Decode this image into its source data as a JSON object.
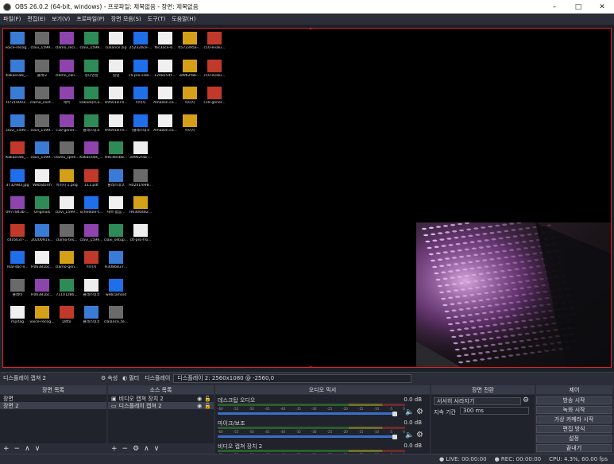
{
  "window": {
    "title": "OBS 26.0.2 (64-bit, windows) - 프로파일: 제목없음 - 장면: 제목없음"
  },
  "menu": [
    "파일(F)",
    "편집(E)",
    "보기(V)",
    "프로파일(P)",
    "장면 모음(S)",
    "도구(T)",
    "도움말(H)"
  ],
  "desktop_icons": [
    {
      "label": "voice-recog..."
    },
    {
      "label": "clavi_1599..."
    },
    {
      "label": "clamo_reci..."
    },
    {
      "label": "clavi_1599..."
    },
    {
      "label": "cialance.zip"
    },
    {
      "label": "252324ce-..."
    },
    {
      "label": "f6c3ace-6..."
    },
    {
      "label": "0572395a-..."
    },
    {
      "label": "c10-evalu..."
    },
    {
      "label": "KakaoTalk_..."
    },
    {
      "label": "클래모\n프로필"
    },
    {
      "label": "clamo_cali..."
    },
    {
      "label": "정다영실\n...-1.jpg"
    },
    {
      "label": "협업\n플러그인"
    },
    {
      "label": "cli-pro-side..."
    },
    {
      "label": "1248254f-..."
    },
    {
      "label": "3d962fab-...\n(1).jpg"
    },
    {
      "label": "c10-evalu..."
    },
    {
      "label": "H7210003..."
    },
    {
      "label": "clamo_cont..."
    },
    {
      "label": "제목\n없음.png"
    },
    {
      "label": "kakaoQrCo..."
    },
    {
      "label": "H950187d..."
    },
    {
      "label": "이미지\n30.jpg"
    },
    {
      "label": "Amazon.co...\nHd Webca..."
    },
    {
      "label": "이미지\n31.png"
    },
    {
      "label": "c10-gener..."
    },
    {
      "label": "clavi_1599..."
    },
    {
      "label": "clavi_1599..."
    },
    {
      "label": "c10-gener..."
    },
    {
      "label": "클래스데코\n활동용-2.jpg"
    },
    {
      "label": "H959187d..."
    },
    {
      "label": "(클래스데코\n_리스-1)..."
    },
    {
      "label": "Amazon.co...\nHd Webca..."
    },
    {
      "label": "이미지\n32.png"
    },
    {
      "label": "KakaoTalk_..."
    },
    {
      "label": "clavi_1599..."
    },
    {
      "label": "clamo_spee..."
    },
    {
      "label": "KakaoTalk_..."
    },
    {
      "label": "H814b5bb..."
    },
    {
      "label": "3d962fab-..."
    },
    {
      "label": "3732983.jpg"
    },
    {
      "label": "WebStorm\n2020.2.2 x64"
    },
    {
      "label": "이미지 1.png"
    },
    {
      "label": "111.pdf"
    },
    {
      "label": "클래스데코\n활동용-3.jpg"
    },
    {
      "label": "Hd241fe98..."
    },
    {
      "label": "0977843b-..."
    },
    {
      "label": "Originals"
    },
    {
      "label": "clavi_1599..."
    },
    {
      "label": "schedule-t..."
    },
    {
      "label": "제목-없음..."
    },
    {
      "label": "H6306482..."
    },
    {
      "label": "c4c6037-..."
    },
    {
      "label": "2020091S..."
    },
    {
      "label": "clamo-tes..."
    },
    {
      "label": "clavi_1599..."
    },
    {
      "label": "clavi_setup..."
    },
    {
      "label": "clt-pro-fro..."
    },
    {
      "label": "real-sbc-li..."
    },
    {
      "label": "H06381bc..."
    },
    {
      "label": "clamo-gen..."
    },
    {
      "label": "이미지\n111.jpg"
    },
    {
      "label": "H3086837..."
    },
    {
      "label": "클래비\n로고필 사..."
    },
    {
      "label": "H06381bc..."
    },
    {
      "label": "711V1z86..."
    },
    {
      "label": "클래스데코\n활동용.pdf"
    },
    {
      "label": "webcamoid"
    },
    {
      "label": "mpitag"
    },
    {
      "label": "voice-recog..."
    },
    {
      "label": "Ditto"
    },
    {
      "label": "클래스데코\n활동용-1.jpg"
    },
    {
      "label": "clalance_te..."
    },
    {
      "label": "clt-pro-bac..."
    }
  ],
  "source_bar": {
    "selected_source": "디스플레이 캡쳐 2",
    "properties_label": "속성",
    "filters_label": "필터",
    "display_label": "디스플레이",
    "display_value": "디스플레이 2: 2560x1080 @ -2560,0"
  },
  "scenes": {
    "title": "장면 목록",
    "items": [
      "장면",
      "장면 2"
    ]
  },
  "sources": {
    "title": "소스 목록",
    "items": [
      "비디오 캡쳐 장치 2",
      "디스플레이 캡쳐 2"
    ]
  },
  "mixer": {
    "title": "오디오 믹서",
    "channels": [
      {
        "name": "데스크탑 오디오",
        "level": "0.0 dB",
        "volume": 0.97
      },
      {
        "name": "마이크/보조",
        "level": "0.0 dB",
        "volume": 0.97
      },
      {
        "name": "비디오 캡쳐 장치 2",
        "level": "0.0 dB",
        "volume": 0.97
      }
    ],
    "ticks": [
      "-60",
      "-55",
      "-50",
      "-45",
      "-40",
      "-35",
      "-30",
      "-25",
      "-20",
      "-15",
      "-10",
      "-5",
      "0"
    ]
  },
  "transitions": {
    "title": "장면 전환",
    "type": "서서히 사라지기",
    "duration_label": "지속 기간",
    "duration_value": "300 ms"
  },
  "controls": {
    "title": "제어",
    "buttons": [
      "방송 시작",
      "녹화 시작",
      "가상 카메라 시작",
      "편집 방식",
      "설정",
      "끝내기"
    ]
  },
  "status": {
    "live": "LIVE: 00:00:00",
    "rec": "REC: 00:00:00",
    "cpu": "CPU: 4.3%, 60.00 fps"
  },
  "colors": {
    "selection_border": "#dd2222",
    "accent_blue": "#3b6fc7"
  }
}
